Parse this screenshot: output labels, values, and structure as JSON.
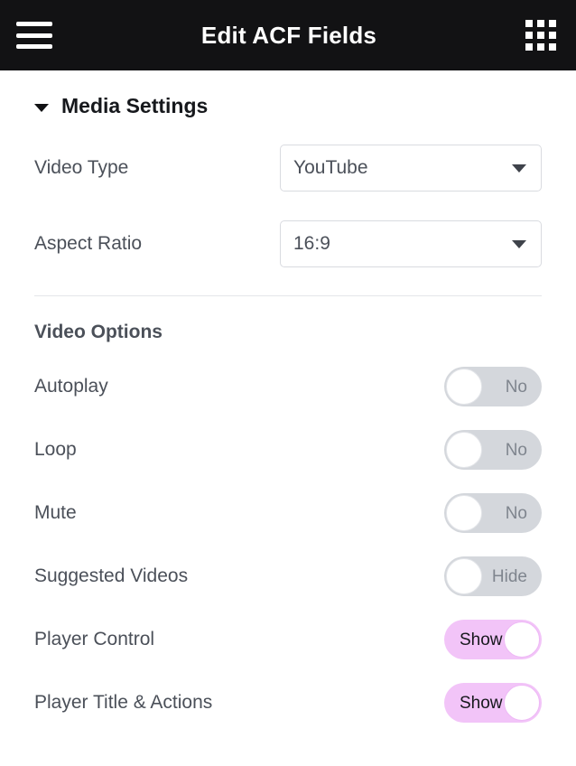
{
  "header": {
    "title": "Edit ACF Fields",
    "menu_icon": "hamburger-icon",
    "apps_icon": "grid-icon"
  },
  "section": {
    "title": "Media Settings",
    "collapse_icon": "caret-down-icon",
    "expanded": true
  },
  "fields": [
    {
      "label": "Video Type",
      "value": "YouTube"
    },
    {
      "label": "Aspect Ratio",
      "value": "16:9"
    }
  ],
  "video_options": {
    "title": "Video Options",
    "toggles": [
      {
        "label": "Autoplay",
        "state": "No",
        "on": false
      },
      {
        "label": "Loop",
        "state": "No",
        "on": false
      },
      {
        "label": "Mute",
        "state": "No",
        "on": false
      },
      {
        "label": "Suggested Videos",
        "state": "Hide",
        "on": false
      },
      {
        "label": "Player Control",
        "state": "Show",
        "on": true
      },
      {
        "label": "Player Title & Actions",
        "state": "Show",
        "on": true
      }
    ]
  },
  "colors": {
    "header_bg": "#121214",
    "toggle_on_track": "#f2c4f8",
    "toggle_off_track": "#d4d7dc",
    "label_text": "#4b5059",
    "border": "#d9dbe0"
  }
}
